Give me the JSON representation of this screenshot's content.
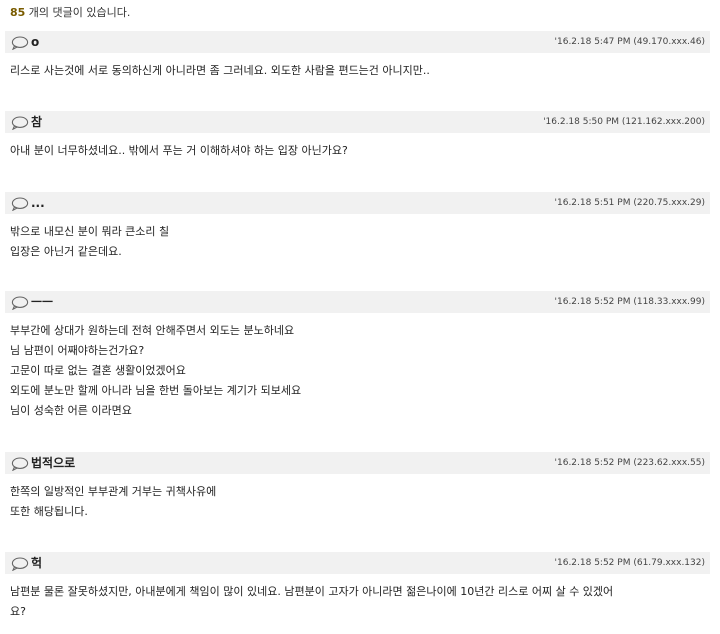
{
  "summary": {
    "count": "85",
    "count_suffix": " 개의 댓글이 있습니다."
  },
  "comments": [
    {
      "author": "o",
      "meta": "'16.2.18 5:47 PM (49.170.xxx.46)",
      "lines": [
        "리스로 사는것에 서로 동의하신게 아니라면 좀 그러네요. 외도한 사람을 편드는건 아니지만.."
      ]
    },
    {
      "author": "참",
      "meta": "'16.2.18 5:50 PM (121.162.xxx.200)",
      "lines": [
        "아내 분이 너무하셨네요.. 밖에서 푸는 거 이해하셔야 하는 입장 아닌가요?"
      ]
    },
    {
      "author": "...",
      "meta": "'16.2.18 5:51 PM (220.75.xxx.29)",
      "lines": [
        "밖으로 내모신 분이 뭐라 큰소리 칠",
        "입장은 아닌거 같은데요."
      ]
    },
    {
      "author": "ㅡㅡ",
      "meta": "'16.2.18 5:52 PM (118.33.xxx.99)",
      "lines": [
        "부부간에 상대가 원하는데 전혀 안해주면서 외도는 분노하네요",
        "님 남편이 어째야하는건가요?",
        "고문이 따로 없는 결혼 생활이었겠어요",
        "외도에 분노만 할께 아니라 님을 한번 돌아보는 계기가 되보세요",
        "님이 성숙한 어른 이라면요"
      ]
    },
    {
      "author": "법적으로",
      "meta": "'16.2.18 5:52 PM (223.62.xxx.55)",
      "lines": [
        "한쪽의 일방적인 부부관계 거부는 귀책사유에",
        "또한 해당됩니다."
      ]
    },
    {
      "author": "헉",
      "meta": "'16.2.18 5:52 PM (61.79.xxx.132)",
      "lines": [
        "남편분 물론 잘못하셨지만, 아내분에게 책임이 많이 있네요. 남편분이 고자가 아니라면 젊은나이에 10년간 리스로 어찌 살 수 있겠어",
        "요?"
      ]
    }
  ]
}
